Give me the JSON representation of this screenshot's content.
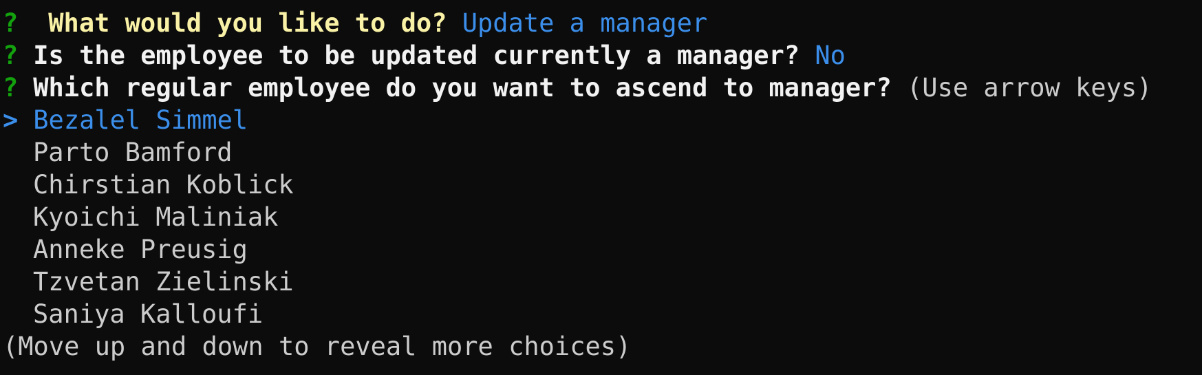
{
  "prompt": {
    "qmark": "?",
    "pointer": ">",
    "history": [
      {
        "question": "What would you like to do?",
        "answer": "Update a manager"
      },
      {
        "question": "Is the employee to be updated currently a manager?",
        "answer": "No"
      }
    ],
    "current": {
      "question": "Which regular employee do you want to ascend to manager?",
      "hint": "(Use arrow keys)"
    },
    "choices": [
      "Bezalel Simmel",
      "Parto Bamford",
      "Chirstian Koblick",
      "Kyoichi Maliniak",
      "Anneke Preusig",
      "Tzvetan Zielinski",
      "Saniya Kalloufi"
    ],
    "selected_index": 0,
    "footer": "(Move up and down to reveal more choices)"
  },
  "colors": {
    "background": "#0c0c0c",
    "qmark": "#13a10e",
    "first_question": "#f9f1a5",
    "answer": "#3b8eea",
    "selected": "#3b8eea",
    "text": "#f2f2f2",
    "muted": "#cccccc"
  }
}
